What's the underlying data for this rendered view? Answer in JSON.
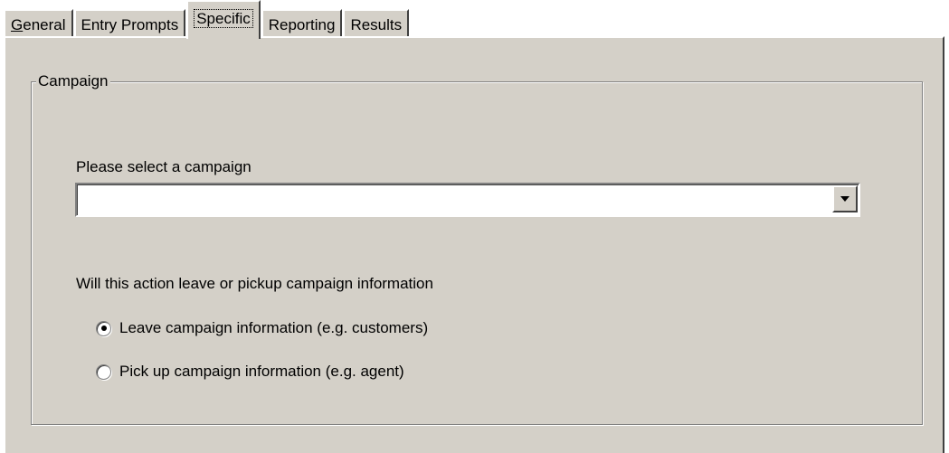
{
  "tabs": [
    {
      "label": "General",
      "active": false
    },
    {
      "label": "Entry Prompts",
      "active": false
    },
    {
      "label": "Specific",
      "active": true
    },
    {
      "label": "Reporting",
      "active": false
    },
    {
      "label": "Results",
      "active": false
    }
  ],
  "groupbox": {
    "title": "Campaign"
  },
  "campaign_select": {
    "label": "Please select a campaign",
    "value": ""
  },
  "direction": {
    "question": "Will this action leave or pickup campaign information",
    "options": [
      {
        "label": "Leave campaign information (e.g. customers)",
        "selected": true
      },
      {
        "label": "Pick up campaign information (e.g. agent)",
        "selected": false
      }
    ]
  },
  "colors": {
    "face": "#d4d0c8",
    "highlight": "#ffffff",
    "shadow": "#808080",
    "dark_shadow": "#404040"
  }
}
